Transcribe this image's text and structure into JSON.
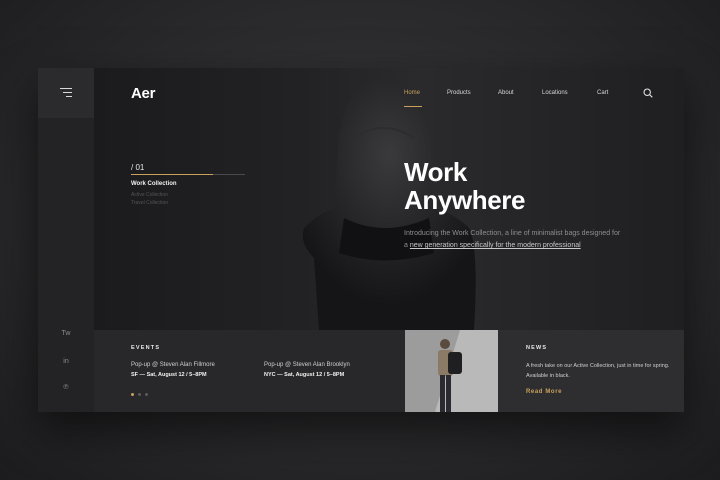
{
  "brand": {
    "logo": "Aer"
  },
  "nav": {
    "items": [
      {
        "label": "Home",
        "active": true
      },
      {
        "label": "Products",
        "active": false
      },
      {
        "label": "About",
        "active": false
      },
      {
        "label": "Locations",
        "active": false
      },
      {
        "label": "Cart",
        "active": false
      }
    ],
    "search_icon": "search-icon",
    "menu_icon": "hamburger-menu-icon"
  },
  "collections": {
    "counter": "/ 01",
    "active": "Work Collection",
    "items": [
      "Active Collection",
      "Travel Collection"
    ]
  },
  "hero": {
    "title_line1": "Work",
    "title_line2": "Anywhere",
    "subtitle_plain": "Introducing the Work Collection, a line of minimalist bags designed for a ",
    "subtitle_link": "new generation specifically for the modern professional"
  },
  "social": {
    "items": [
      {
        "icon": "twitter-icon",
        "glyph": "Tw"
      },
      {
        "icon": "linkedin-icon",
        "glyph": "in"
      },
      {
        "icon": "pinterest-icon",
        "glyph": "℗"
      }
    ]
  },
  "events": {
    "label": "EVENTS",
    "items": [
      {
        "title": "Pop-up @ Steven Alan Fillmore",
        "date": "SF — Sat, August 12 / 5–8PM"
      },
      {
        "title": "Pop-up @ Steven Alan Brooklyn",
        "date": "NYC — Sat, August 12 / 5–8PM"
      }
    ],
    "pagination": {
      "count": 3,
      "active": 1
    }
  },
  "news": {
    "label": "NEWS",
    "text": "A fresh take on our Active Collection, just in time for spring. Available in black.",
    "read_more": "Read More"
  },
  "colors": {
    "accent": "#c9a15c",
    "background": "#1d1d1f",
    "text": "#ffffff"
  }
}
